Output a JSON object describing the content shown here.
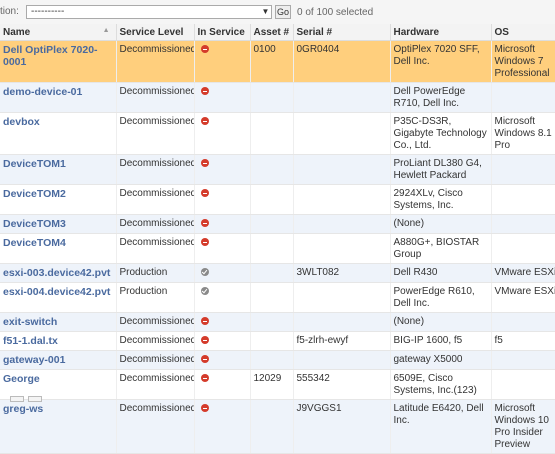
{
  "actions": {
    "label": "tion:",
    "select_value": "----------",
    "go_label": "Go",
    "selection_count": "0 of 100 selected"
  },
  "columns": [
    "Name",
    "Service Level",
    "In Service",
    "Asset #",
    "Serial #",
    "Hardware",
    "OS"
  ],
  "colors": {
    "selected_row": "#ffcf7d",
    "alt_row": "#eef3fa",
    "link": "#4a6a9f",
    "decommissioned_icon": "#d43b2b",
    "production_icon": "#8a8a8a"
  },
  "rows": [
    {
      "name": "Dell OptiPlex 7020-0001",
      "service_level": "Decommissioned",
      "in_service_icon": "no-entry-icon",
      "asset": "0100",
      "serial": "0GR0404",
      "hardware": "OptiPlex 7020 SFF, Dell Inc.",
      "os": "Microsoft Windows 7 Professional",
      "selected": true
    },
    {
      "name": "demo-device-01",
      "service_level": "Decommissioned",
      "in_service_icon": "no-entry-icon",
      "asset": "",
      "serial": "",
      "hardware": "Dell PowerEdge R710, Dell Inc.",
      "os": ""
    },
    {
      "name": "devbox",
      "service_level": "Decommissioned",
      "in_service_icon": "no-entry-icon",
      "asset": "",
      "serial": "",
      "hardware": "P35C-DS3R, Gigabyte Technology Co., Ltd.",
      "os": "Microsoft Windows 8.1 Pro"
    },
    {
      "name": "DeviceTOM1",
      "service_level": "Decommissioned",
      "in_service_icon": "no-entry-icon",
      "asset": "",
      "serial": "",
      "hardware": "ProLiant DL380 G4, Hewlett Packard",
      "os": ""
    },
    {
      "name": "DeviceTOM2",
      "service_level": "Decommissioned",
      "in_service_icon": "no-entry-icon",
      "asset": "",
      "serial": "",
      "hardware": "2924XLv, Cisco Systems, Inc.",
      "os": ""
    },
    {
      "name": "DeviceTOM3",
      "service_level": "Decommissioned",
      "in_service_icon": "no-entry-icon",
      "asset": "",
      "serial": "",
      "hardware": "(None)",
      "os": ""
    },
    {
      "name": "DeviceTOM4",
      "service_level": "Decommissioned",
      "in_service_icon": "no-entry-icon",
      "asset": "",
      "serial": "",
      "hardware": "A880G+, BIOSTAR Group",
      "os": ""
    },
    {
      "name": "esxi-003.device42.pvt",
      "service_level": "Production",
      "in_service_icon": "check-icon",
      "asset": "",
      "serial": "3WLT082",
      "hardware": "Dell R430",
      "os": "VMware ESXi"
    },
    {
      "name": "esxi-004.device42.pvt",
      "service_level": "Production",
      "in_service_icon": "check-icon",
      "asset": "",
      "serial": "",
      "hardware": "PowerEdge R610, Dell Inc.",
      "os": "VMware ESXi"
    },
    {
      "name": "exit-switch",
      "service_level": "Decommissioned",
      "in_service_icon": "no-entry-icon",
      "asset": "",
      "serial": "",
      "hardware": "(None)",
      "os": ""
    },
    {
      "name": "f51-1.dal.tx",
      "service_level": "Decommissioned",
      "in_service_icon": "no-entry-icon",
      "asset": "",
      "serial": "f5-zlrh-ewyf",
      "hardware": "BIG-IP 1600, f5",
      "os": "f5"
    },
    {
      "name": "gateway-001",
      "service_level": "Decommissioned",
      "in_service_icon": "no-entry-icon",
      "asset": "",
      "serial": "",
      "hardware": "gateway X5000",
      "os": ""
    },
    {
      "name": "George",
      "service_level": "Decommissioned",
      "in_service_icon": "no-entry-icon",
      "asset": "12029",
      "serial": "555342",
      "hardware": "6509E, Cisco Systems, Inc.(123)",
      "os": ""
    },
    {
      "name": "greg-ws",
      "service_level": "Decommissioned",
      "in_service_icon": "no-entry-icon",
      "asset": "",
      "serial": "J9VGGS1",
      "hardware": "Latitude E6420, Dell Inc.",
      "os": "Microsoft Windows 10 Pro Insider Preview"
    }
  ]
}
